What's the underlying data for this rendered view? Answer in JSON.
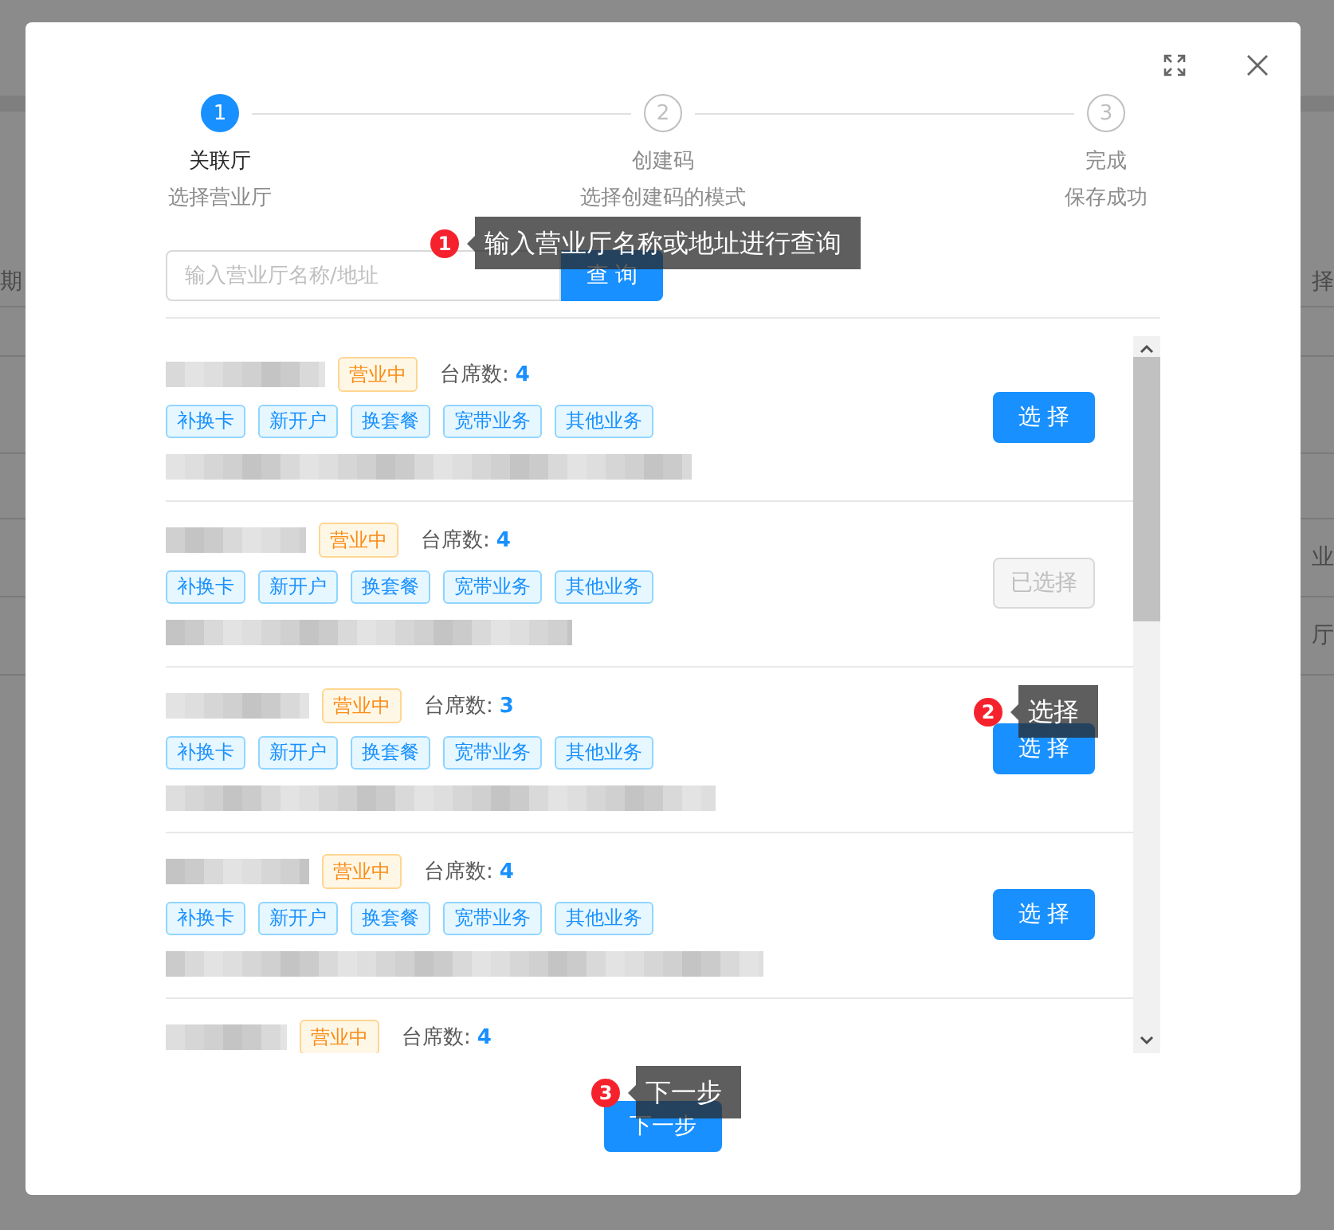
{
  "background": {
    "left_texts": [
      "期"
    ],
    "right_texts": [
      "择",
      "业",
      "厅"
    ]
  },
  "steps": [
    {
      "number": "1",
      "title": "关联厅",
      "description": "选择营业厅",
      "selected": true
    },
    {
      "number": "2",
      "title": "创建码",
      "description": "选择创建码的模式",
      "selected": false
    },
    {
      "number": "3",
      "title": "完成",
      "description": "保存成功",
      "selected": false
    }
  ],
  "search": {
    "placeholder": "输入营业厅名称/地址",
    "button": "查 询"
  },
  "halls": [
    {
      "status": "营业中",
      "seats_label": "台席数:",
      "seats": "4",
      "services": [
        "补换卡",
        "新开户",
        "换套餐",
        "宽带业务",
        "其他业务"
      ],
      "action": "选 择",
      "disabled": false
    },
    {
      "status": "营业中",
      "seats_label": "台席数:",
      "seats": "4",
      "services": [
        "补换卡",
        "新开户",
        "换套餐",
        "宽带业务",
        "其他业务"
      ],
      "action": "已选择",
      "disabled": true
    },
    {
      "status": "营业中",
      "seats_label": "台席数:",
      "seats": "3",
      "services": [
        "补换卡",
        "新开户",
        "换套餐",
        "宽带业务",
        "其他业务"
      ],
      "action": "选 择",
      "disabled": false
    },
    {
      "status": "营业中",
      "seats_label": "台席数:",
      "seats": "4",
      "services": [
        "补换卡",
        "新开户",
        "换套餐",
        "宽带业务",
        "其他业务"
      ],
      "action": "选 择",
      "disabled": false
    },
    {
      "status": "营业中",
      "seats_label": "台席数:",
      "seats": "4"
    }
  ],
  "next_button": "下一步",
  "hints": [
    {
      "number": "1",
      "text": "输入营业厅名称或地址进行查询"
    },
    {
      "number": "2",
      "text": "选择"
    },
    {
      "number": "3",
      "text": "下一步"
    }
  ]
}
